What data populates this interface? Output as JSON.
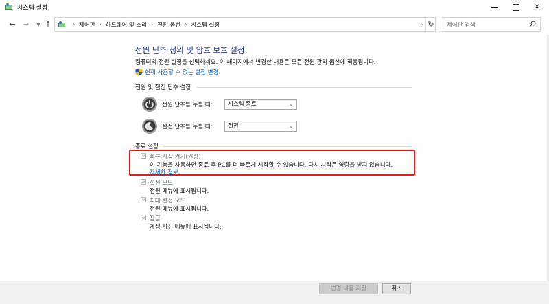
{
  "window": {
    "title": "시스템 설정"
  },
  "address": {
    "crumbs": [
      "제어판",
      "하드웨어 및 소리",
      "전원 옵션",
      "시스템 설정"
    ],
    "search_placeholder": "제어판 검색"
  },
  "page": {
    "title": "전원 단추 정의 및 암호 보호 설정",
    "description": "컴퓨터의 전원 설정을 선택하세요. 이 페이지에서 변경한 내용은 모든 전원 관리 옵션에 적용됩니다.",
    "change_link": "현재 사용할 수 없는 설정 변경"
  },
  "power_section": {
    "heading": "전원 및 절전 단추 설정",
    "rows": [
      {
        "label": "전원 단추를 누를 때:",
        "value": "시스템 종료"
      },
      {
        "label": "절전 단추를 누를 때:",
        "value": "절전"
      }
    ]
  },
  "shutdown_section": {
    "heading": "종료 설정",
    "options": [
      {
        "title": "빠른 시작 켜기(권장)",
        "description": "이 기능을 사용하면 종료 후 PC를 더 빠르게 시작할 수 있습니다. 다시 시작은 영향을 받지 않습니다.",
        "link": "자세한 정보",
        "checked": true
      },
      {
        "title": "절전 모드",
        "description": "전원 메뉴에 표시됩니다.",
        "checked": true
      },
      {
        "title": "최대 절전 모드",
        "description": "전원 메뉴에 표시됩니다.",
        "checked": true
      },
      {
        "title": "잠금",
        "description": "계정 사진 메뉴에 표시됩니다.",
        "checked": true
      }
    ]
  },
  "footer": {
    "save_label": "변경 내용 저장",
    "cancel_label": "취소"
  },
  "colors": {
    "title_blue": "#1e3287",
    "link_blue": "#0b5fc4",
    "highlight_red": "#e21c1c"
  }
}
